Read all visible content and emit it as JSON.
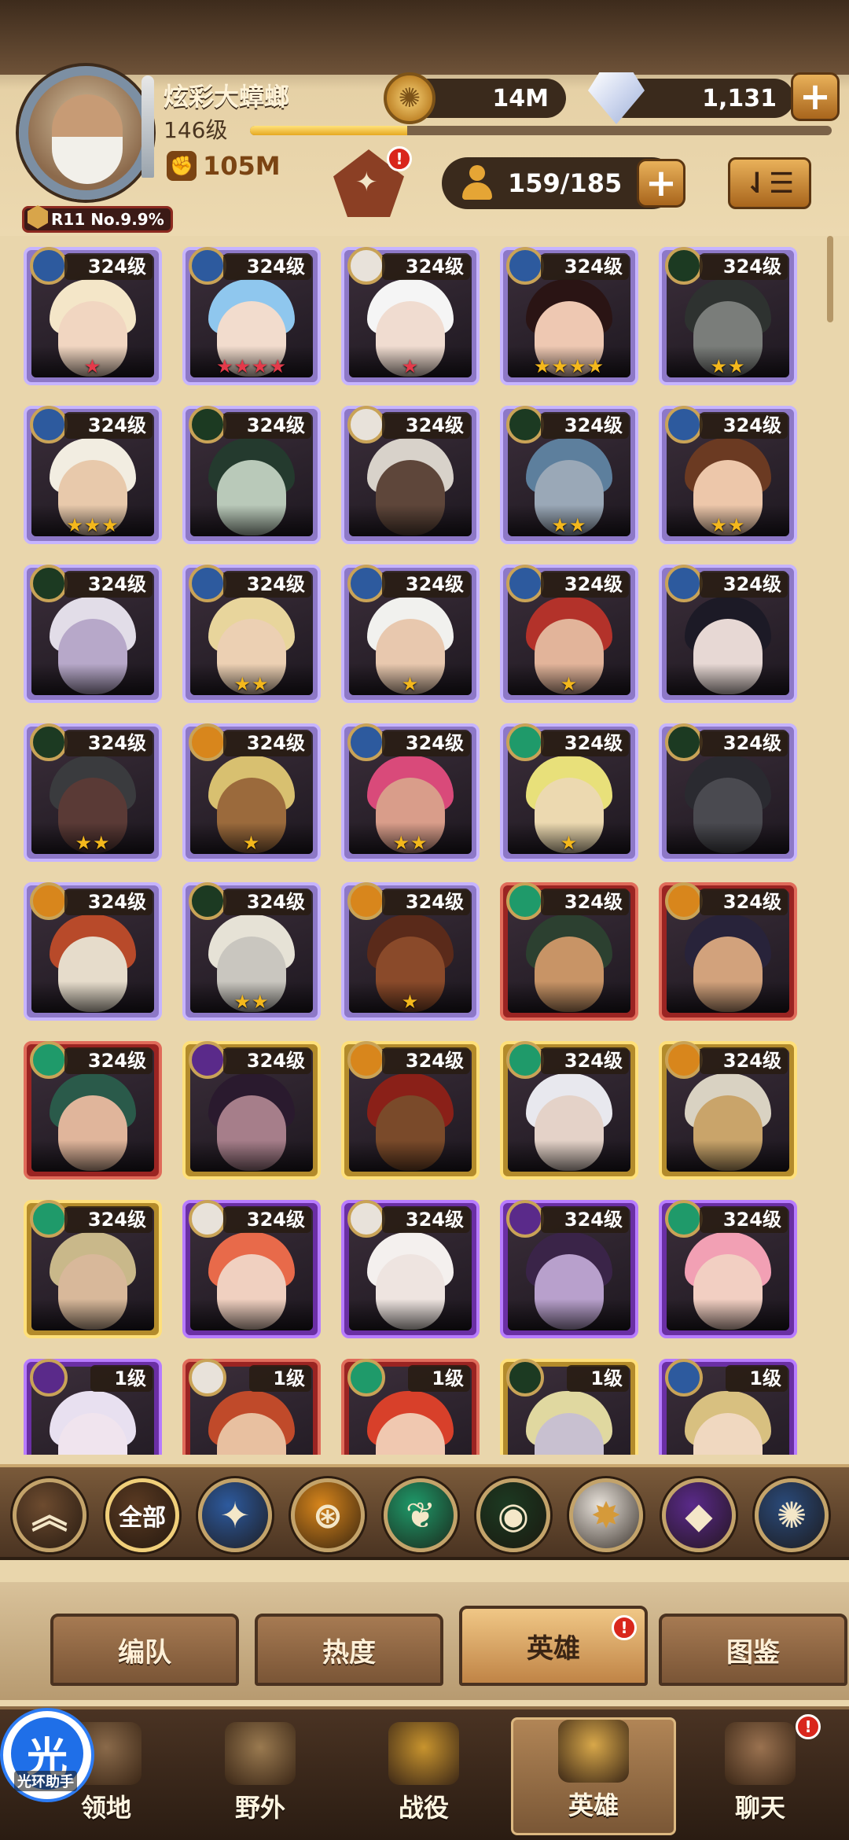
{
  "player": {
    "name": "炫彩大蟑螂",
    "level": "146级",
    "xp_progress": 0.27,
    "power": "105M",
    "rank": "R11 No.9.9%"
  },
  "resources": {
    "gold": "14M",
    "gems": "1,131"
  },
  "hero_count": "159/185",
  "colors": {
    "accent_gold": "#e5a535",
    "notification_red": "#d9261c",
    "bg": "#e9d6ac"
  },
  "heroes": [
    {
      "level": "324级",
      "stars": "★",
      "star_color": "#e43a4a",
      "frame": "purple",
      "faction": "lightbearer",
      "skin": "#f1d6c1",
      "hair": "#f4e6c8"
    },
    {
      "level": "324级",
      "stars": "★★★★",
      "star_color": "#e43a4a",
      "frame": "purple",
      "faction": "lightbearer",
      "skin": "#f2dccd",
      "hair": "#8fc7ee"
    },
    {
      "level": "324级",
      "stars": "★",
      "star_color": "#e43a4a",
      "frame": "purple",
      "faction": "celestial",
      "skin": "#f0dcd0",
      "hair": "#f5f5f5"
    },
    {
      "level": "324级",
      "stars": "★★★★",
      "star_color": "#f4b81c",
      "frame": "purple",
      "faction": "lightbearer",
      "skin": "#eec8b2",
      "hair": "#2a1414"
    },
    {
      "level": "324级",
      "stars": "★★",
      "star_color": "#f4b81c",
      "frame": "purple",
      "faction": "graveborn",
      "skin": "#7a7d7a",
      "hair": "#2e3230"
    },
    {
      "level": "324级",
      "stars": "★★★",
      "star_color": "#f4b81c",
      "frame": "purple",
      "faction": "lightbearer",
      "skin": "#e8c9ab",
      "hair": "#f2ede1"
    },
    {
      "level": "324级",
      "stars": "",
      "star_color": "#f4b81c",
      "frame": "purple",
      "faction": "graveborn",
      "skin": "#b9c9b9",
      "hair": "#243a2e"
    },
    {
      "level": "324级",
      "stars": "",
      "star_color": "#f4b81c",
      "frame": "purple",
      "faction": "celestial",
      "skin": "#5e463a",
      "hair": "#d8d2ca"
    },
    {
      "level": "324级",
      "stars": "★★",
      "star_color": "#f4b81c",
      "frame": "purple",
      "faction": "graveborn",
      "skin": "#9aa8b7",
      "hair": "#5d7f9d"
    },
    {
      "level": "324级",
      "stars": "★★",
      "star_color": "#f4b81c",
      "frame": "purple",
      "faction": "lightbearer",
      "skin": "#edc7aa",
      "hair": "#6b3a22"
    },
    {
      "level": "324级",
      "stars": "",
      "star_color": "#f4b81c",
      "frame": "purple",
      "faction": "graveborn",
      "skin": "#b7a8c9",
      "hair": "#e2dde8"
    },
    {
      "level": "324级",
      "stars": "★★",
      "star_color": "#f4b81c",
      "frame": "purple",
      "faction": "lightbearer",
      "skin": "#ecd0b3",
      "hair": "#e8d59c"
    },
    {
      "level": "324级",
      "stars": "★",
      "star_color": "#f4b81c",
      "frame": "purple",
      "faction": "lightbearer",
      "skin": "#e8c8ae",
      "hair": "#f1f1ee"
    },
    {
      "level": "324级",
      "stars": "★",
      "star_color": "#f4b81c",
      "frame": "purple",
      "faction": "lightbearer",
      "skin": "#e2b49a",
      "hair": "#b3322a"
    },
    {
      "level": "324级",
      "stars": "",
      "star_color": "#f4b81c",
      "frame": "purple",
      "faction": "lightbearer",
      "skin": "#e7d8d4",
      "hair": "#1c1a26"
    },
    {
      "level": "324级",
      "stars": "★★",
      "star_color": "#f4b81c",
      "frame": "purple",
      "faction": "graveborn",
      "skin": "#5a3a36",
      "hair": "#3a3b3e"
    },
    {
      "level": "324级",
      "stars": "★",
      "star_color": "#f4b81c",
      "frame": "purple",
      "faction": "mauler",
      "skin": "#9b6a3c",
      "hair": "#d8c070"
    },
    {
      "level": "324级",
      "stars": "★★",
      "star_color": "#f4b81c",
      "frame": "purple",
      "faction": "lightbearer",
      "skin": "#d99d8a",
      "hair": "#d94a7a"
    },
    {
      "level": "324级",
      "stars": "★",
      "star_color": "#f4b81c",
      "frame": "purple",
      "faction": "wilder",
      "skin": "#ecd9b0",
      "hair": "#e8e07a"
    },
    {
      "level": "324级",
      "stars": "",
      "star_color": "#f4b81c",
      "frame": "purple",
      "faction": "graveborn",
      "skin": "#4a4a50",
      "hair": "#2a2a30"
    },
    {
      "level": "324级",
      "stars": "",
      "star_color": "#f4b81c",
      "frame": "purple",
      "faction": "mauler",
      "skin": "#e6dccb",
      "hair": "#b84a2a"
    },
    {
      "level": "324级",
      "stars": "★★",
      "star_color": "#f4b81c",
      "frame": "purple",
      "faction": "graveborn",
      "skin": "#c9c6bf",
      "hair": "#e6e2d6"
    },
    {
      "level": "324级",
      "stars": "★",
      "star_color": "#f4b81c",
      "frame": "purple",
      "faction": "mauler",
      "skin": "#8a4a2a",
      "hair": "#5a2a1a"
    },
    {
      "level": "324级",
      "stars": "",
      "star_color": "#f4b81c",
      "frame": "red",
      "faction": "wilder",
      "skin": "#c89466",
      "hair": "#2c4030"
    },
    {
      "level": "324级",
      "stars": "",
      "star_color": "#f4b81c",
      "frame": "red",
      "faction": "mauler",
      "skin": "#d2a27c",
      "hair": "#28233a"
    },
    {
      "level": "324级",
      "stars": "",
      "star_color": "#f4b81c",
      "frame": "red",
      "faction": "wilder",
      "skin": "#e0b59b",
      "hair": "#2a5a4a"
    },
    {
      "level": "324级",
      "stars": "",
      "star_color": "#f4b81c",
      "frame": "gold",
      "faction": "hypogean",
      "skin": "#a67e8a",
      "hair": "#2a1a2e"
    },
    {
      "level": "324级",
      "stars": "",
      "star_color": "#f4b81c",
      "frame": "gold",
      "faction": "mauler",
      "skin": "#7a4a2a",
      "hair": "#8a2018"
    },
    {
      "level": "324级",
      "stars": "",
      "star_color": "#f4b81c",
      "frame": "gold",
      "faction": "wilder",
      "skin": "#e4d2c8",
      "hair": "#e8e8ee"
    },
    {
      "level": "324级",
      "stars": "",
      "star_color": "#f4b81c",
      "frame": "gold",
      "faction": "mauler",
      "skin": "#c9a46a",
      "hair": "#d9d2c2"
    },
    {
      "level": "324级",
      "stars": "",
      "star_color": "#f4b81c",
      "frame": "gold",
      "faction": "wilder",
      "skin": "#d8b89a",
      "hair": "#c9b88a"
    },
    {
      "level": "324级",
      "stars": "",
      "star_color": "#f4b81c",
      "frame": "violet",
      "faction": "celestial",
      "skin": "#f0d0c0",
      "hair": "#e86a4a"
    },
    {
      "level": "324级",
      "stars": "",
      "star_color": "#f4b81c",
      "frame": "violet",
      "faction": "celestial",
      "skin": "#eee4e0",
      "hair": "#f4f0ee"
    },
    {
      "level": "324级",
      "stars": "",
      "star_color": "#f4b81c",
      "frame": "violet",
      "faction": "hypogean",
      "skin": "#b8a0cc",
      "hair": "#3a2448"
    },
    {
      "level": "324级",
      "stars": "",
      "star_color": "#f4b81c",
      "frame": "violet",
      "faction": "wilder",
      "skin": "#f2cfc2",
      "hair": "#f2a0b4"
    },
    {
      "level": "1级",
      "stars": "",
      "star_color": "#f4b81c",
      "frame": "violet",
      "faction": "hypogean",
      "skin": "#f0e4ee",
      "hair": "#e8e0f0"
    },
    {
      "level": "1级",
      "stars": "",
      "star_color": "#f4b81c",
      "frame": "red",
      "faction": "celestial",
      "skin": "#e8c0a0",
      "hair": "#c04a2a"
    },
    {
      "level": "1级",
      "stars": "",
      "star_color": "#f4b81c",
      "frame": "red",
      "faction": "wilder",
      "skin": "#f0c8b0",
      "hair": "#d8402a"
    },
    {
      "level": "1级",
      "stars": "",
      "star_color": "#f4b81c",
      "frame": "gold",
      "faction": "graveborn",
      "skin": "#c8c0d0",
      "hair": "#e0d8a0"
    },
    {
      "level": "1级",
      "stars": "",
      "star_color": "#f4b81c",
      "frame": "violet",
      "faction": "lightbearer",
      "skin": "#f0d8c0",
      "hair": "#d8c080"
    }
  ],
  "factions": [
    {
      "name": "collapse",
      "icon": "chevron-up-icon",
      "glyph": "︽",
      "color": "#6d4b2f"
    },
    {
      "name": "all",
      "label": "全部",
      "color": "#5a3a22"
    },
    {
      "name": "lightbearer",
      "icon": "lightbearer-icon",
      "glyph": "✦",
      "color": "#2d5a9e"
    },
    {
      "name": "mauler",
      "icon": "mauler-icon",
      "glyph": "⊛",
      "color": "#d8861c"
    },
    {
      "name": "wilder",
      "icon": "wilder-icon",
      "glyph": "❦",
      "color": "#1f9a6a"
    },
    {
      "name": "graveborn",
      "icon": "graveborn-icon",
      "glyph": "◉",
      "color": "#1c3a22"
    },
    {
      "name": "celestial",
      "icon": "celestial-icon",
      "glyph": "✸",
      "color": "#e8e2da"
    },
    {
      "name": "hypogean",
      "icon": "hypogean-icon",
      "glyph": "◆",
      "color": "#5a2a8a"
    },
    {
      "name": "dimensional",
      "icon": "dimensional-icon",
      "glyph": "✺",
      "color": "#2a4a7a"
    }
  ],
  "subtabs": [
    "编队",
    "热度",
    "英雄",
    "图鉴"
  ],
  "subtab_active": "英雄",
  "nav": [
    {
      "label": "领地",
      "icon": "castle-icon",
      "color": "#8a6a4a"
    },
    {
      "label": "野外",
      "icon": "map-scroll-icon",
      "color": "#9a7a50"
    },
    {
      "label": "战役",
      "icon": "sword-crest-icon",
      "color": "#c8942e"
    },
    {
      "label": "英雄",
      "icon": "hero-helmet-icon",
      "color": "#d8a84a"
    },
    {
      "label": "聊天",
      "icon": "chat-icon",
      "color": "#9a7250"
    }
  ],
  "nav_active": "英雄",
  "assistant": {
    "glyph": "光",
    "label": "光环助手"
  },
  "badges": {
    "new": "!"
  }
}
